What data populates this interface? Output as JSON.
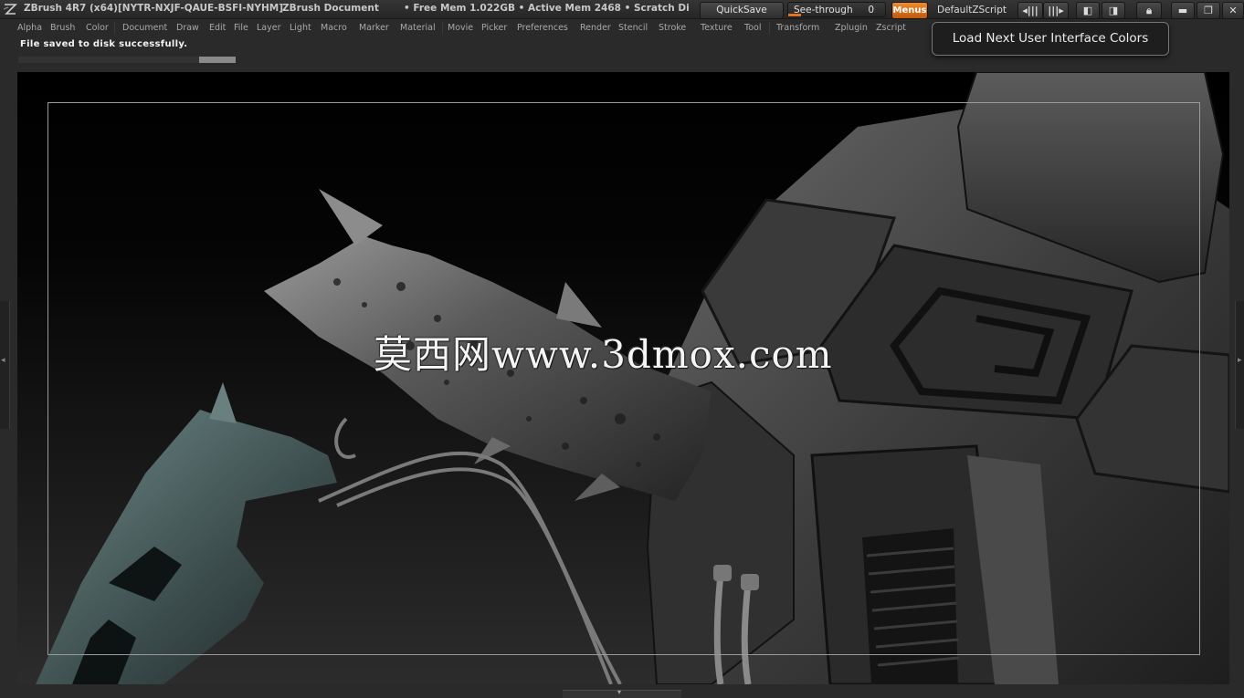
{
  "titlebar": {
    "app_title": "ZBrush 4R7 (x64)[NYTR-NXJF-QAUE-BSFI-NYHM]",
    "doc_title": "ZBrush Document",
    "mem_info": "• Free Mem 1.022GB • Active Mem 2468 • Scratch Di",
    "quicksave_label": "QuickSave",
    "seethrough_label": "See-through",
    "seethrough_value": "0",
    "menus_label": "Menus",
    "default_script_label": "DefaultZScript",
    "accent_color": "#e2721c"
  },
  "menubar": {
    "items": [
      "Alpha",
      "Brush",
      "Color",
      "Document",
      "Draw",
      "Edit",
      "File",
      "Layer",
      "Light",
      "Macro",
      "Marker",
      "Material",
      "Movie",
      "Picker",
      "Preferences",
      "Render",
      "Stencil",
      "Stroke",
      "Texture",
      "Tool",
      "Transform",
      "Zplugin",
      "Zscript"
    ]
  },
  "status": {
    "message": "File saved to disk successfully.",
    "progress": 0.17
  },
  "tooltip": {
    "text": "Load Next User Interface Colors"
  },
  "canvas": {
    "watermark": "莫西网www.3dmox.com"
  }
}
